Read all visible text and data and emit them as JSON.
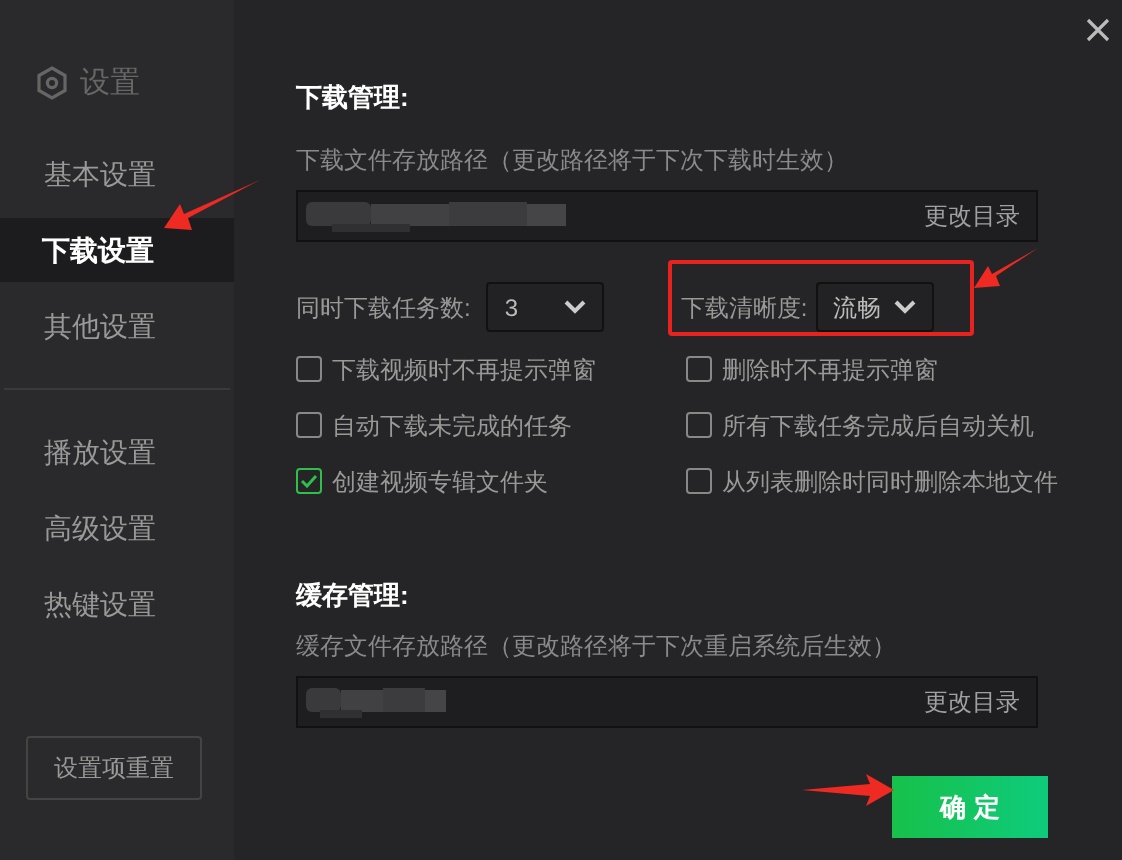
{
  "sidebar": {
    "title": "设置",
    "items": [
      {
        "label": "基本设置",
        "selected": false
      },
      {
        "label": "下载设置",
        "selected": true
      },
      {
        "label": "其他设置",
        "selected": false
      },
      {
        "label": "播放设置",
        "selected": false,
        "divider_before": true
      },
      {
        "label": "高级设置",
        "selected": false
      },
      {
        "label": "热键设置",
        "selected": false
      }
    ],
    "reset_button": "设置项重置"
  },
  "download": {
    "title": "下载管理:",
    "path_label": "下载文件存放路径（更改路径将于下次下载时生效）",
    "change_button": "更改目录",
    "tasks_label": "同时下载任务数:",
    "tasks_value": "3",
    "quality_label": "下载清晰度:",
    "quality_value": "流畅",
    "options": [
      {
        "label": "下载视频时不再提示弹窗",
        "checked": false
      },
      {
        "label": "删除时不再提示弹窗",
        "checked": false
      },
      {
        "label": "自动下载未完成的任务",
        "checked": false
      },
      {
        "label": "所有下载任务完成后自动关机",
        "checked": false
      },
      {
        "label": "创建视频专辑文件夹",
        "checked": true
      },
      {
        "label": "从列表删除时同时删除本地文件",
        "checked": false
      }
    ]
  },
  "cache": {
    "title": "缓存管理:",
    "path_label": "缓存文件存放路径（更改路径将于下次重启系统后生效）",
    "change_button": "更改目录"
  },
  "confirm_button": "确 定"
}
